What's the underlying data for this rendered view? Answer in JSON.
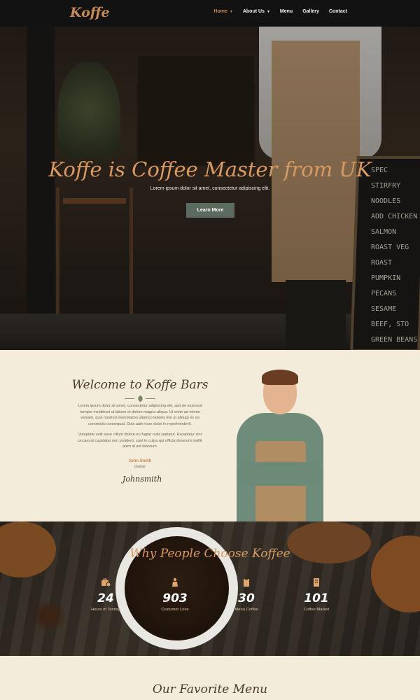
{
  "nav": {
    "logo": "Koffe",
    "items": [
      {
        "label": "Home",
        "dropdown": true,
        "active": true
      },
      {
        "label": "About Us",
        "dropdown": true,
        "active": false
      },
      {
        "label": "Menu",
        "dropdown": false,
        "active": false
      },
      {
        "label": "Gallery",
        "dropdown": false,
        "active": false
      },
      {
        "label": "Contact",
        "dropdown": false,
        "active": false
      }
    ]
  },
  "hero": {
    "title": "Koffe is Coffee Master from UK",
    "subtitle": "Lorem ipsum dolor sit amet, consectetur adipiscing elit.",
    "button": "Learn More",
    "board_lines": [
      "SPEC",
      "STIRFRY",
      "NOODLES",
      "ADD CHICKEN",
      "SALMON",
      "ROAST VEG",
      "ROAST PUMPKIN",
      "PECANS SESAME",
      "BEEF, STO",
      "GREEN BEANS"
    ]
  },
  "welcome": {
    "title": "Welcome to Koffe Bars",
    "paragraph1": "Lorem ipsum dolor sit amet, consectetur adipiscing elit, sed do eiusmod tempor incididunt ut labore et dolore magna aliqua. Ut enim ad minim veniam, quis nostrud exercitation ullamco laboris nisi ut aliquip ex ea commodo consequat. Duis aute irure dolor in reprehenderit.",
    "paragraph2": "Voluptate velit esse cillum dolore eu fugiat nulla pariatur. Excepteur sint occaecat cupidatat non proident, sunt in culpa qui officia deserunt mollit anim id est laborum.",
    "owner_name": "John Smith",
    "owner_role": "Owner",
    "signature": "Johnsmith"
  },
  "why": {
    "title": "Why People Choose Koffee",
    "stats": [
      {
        "icon": "briefcase-clock-icon",
        "value": "24",
        "label": "Hours of Testing"
      },
      {
        "icon": "barista-icon",
        "value": "903",
        "label": "Costumer Love"
      },
      {
        "icon": "clipboard-icon",
        "value": "30",
        "label": "Menu Coffee"
      },
      {
        "icon": "building-icon",
        "value": "101",
        "label": "Coffee Market"
      }
    ]
  },
  "menu_section": {
    "title": "Our Favorite Menu"
  },
  "colors": {
    "accent": "#c88a56",
    "button": "#5b6b5f",
    "dark": "#121212",
    "cream": "#f3ecdb"
  }
}
